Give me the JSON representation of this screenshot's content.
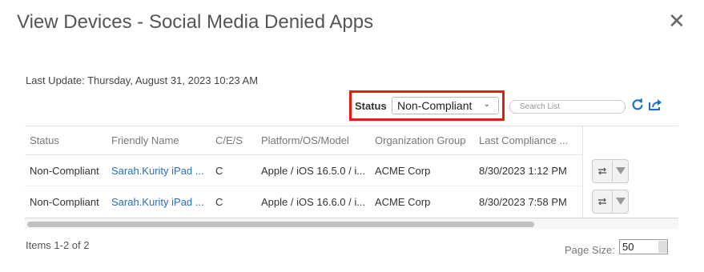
{
  "dialog": {
    "title": "View Devices - Social Media Denied Apps",
    "close_glyph": "✕"
  },
  "last_update": "Last Update: Thursday, August 31, 2023 10:23 AM",
  "toolbar": {
    "status_label": "Status",
    "status_value": "Non-Compliant",
    "search_placeholder": "Search List",
    "refresh_icon": "refresh-icon",
    "export_icon": "export-icon"
  },
  "table": {
    "columns": [
      "Status",
      "Friendly Name",
      "C/E/S",
      "Platform/OS/Model",
      "Organization Group",
      "Last Compliance ..."
    ],
    "rows": [
      {
        "status": "Non-Compliant",
        "friendly_name": "Sarah.Kurity iPad ...",
        "ces": "C",
        "platform": "Apple / iOS 16.5.0 / i...",
        "org_group": "ACME Corp",
        "last_compliance": "8/30/2023 1:12 PM"
      },
      {
        "status": "Non-Compliant",
        "friendly_name": "Sarah.Kurity iPad ...",
        "ces": "C",
        "platform": "Apple / iOS 16.6.0 / i...",
        "org_group": "ACME Corp",
        "last_compliance": "8/30/2023 7:58 PM"
      }
    ]
  },
  "footer": {
    "items_text": "Items 1-2 of 2",
    "page_size_label": "Page Size:",
    "page_size_value": "50"
  },
  "colors": {
    "highlight_border": "#e01e12",
    "link": "#2a6ebb",
    "icon_blue": "#1e6fc8"
  }
}
